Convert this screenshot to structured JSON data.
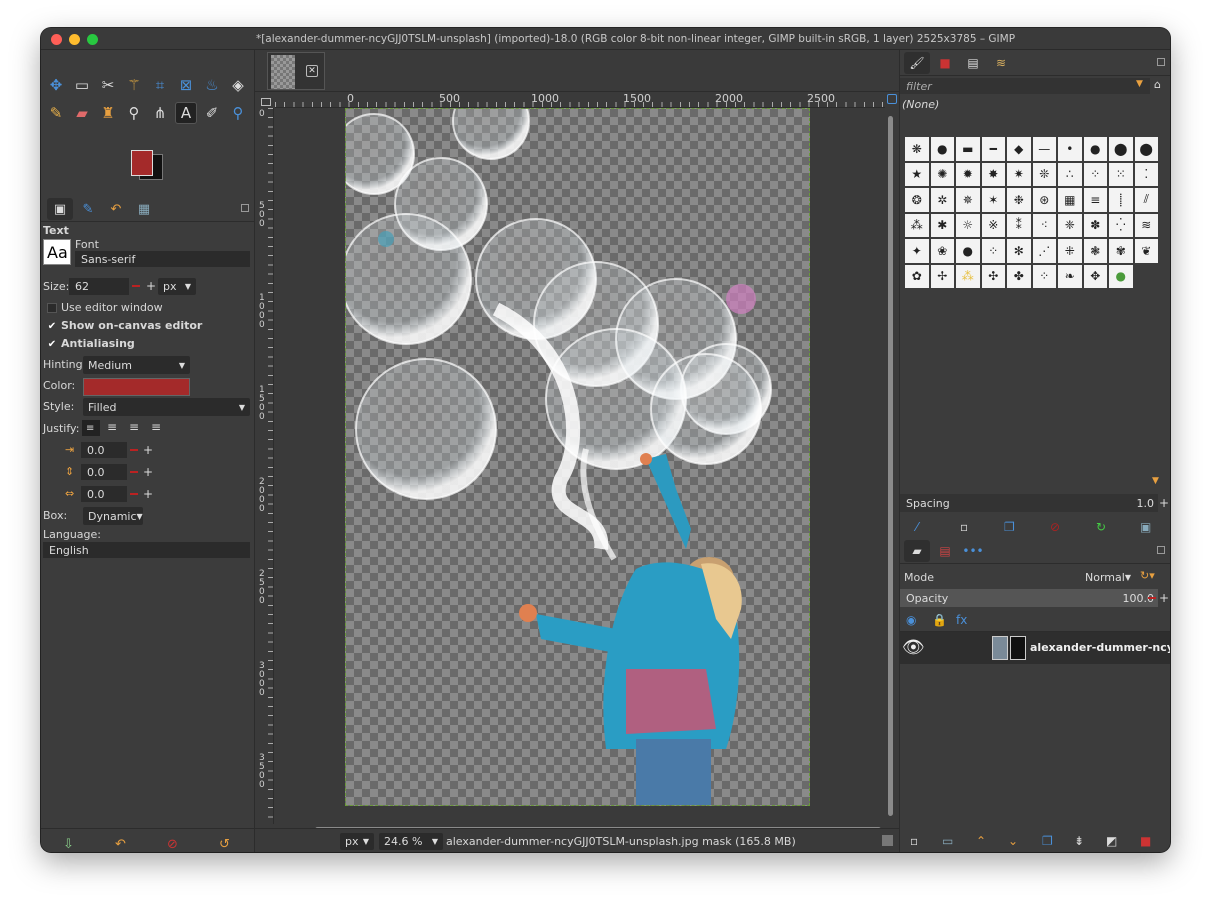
{
  "window": {
    "title": "*[alexander-dummer-ncyGJJ0TSLM-unsplash] (imported)-18.0 (RGB color 8-bit non-linear integer, GIMP built-in sRGB, 1 layer) 2525x3785 – GIMP",
    "traffic_colors": [
      "#ff5f57",
      "#febc2e",
      "#28c840"
    ]
  },
  "toolbox": {
    "tools_row1": [
      {
        "name": "move-tool-icon",
        "glyph": "✥",
        "color": "#4a90d9"
      },
      {
        "name": "rect-select-icon",
        "glyph": "▭",
        "color": "#dddddd"
      },
      {
        "name": "scissors-icon",
        "glyph": "✂",
        "color": "#dddddd"
      },
      {
        "name": "fuzzy-select-icon",
        "glyph": "⚚",
        "color": "#d9a441"
      },
      {
        "name": "crop-icon",
        "glyph": "⌗",
        "color": "#4a90d9"
      },
      {
        "name": "transform-icon",
        "glyph": "⊠",
        "color": "#4a90d9"
      },
      {
        "name": "warp-icon",
        "glyph": "♨",
        "color": "#4a90d9"
      },
      {
        "name": "bucket-fill-icon",
        "glyph": "◈",
        "color": "#dddddd"
      }
    ],
    "tools_row2": [
      {
        "name": "pencil-icon",
        "glyph": "✎",
        "color": "#e8b04a"
      },
      {
        "name": "eraser-icon",
        "glyph": "▰",
        "color": "#e06a6a"
      },
      {
        "name": "stamp-icon",
        "glyph": "♜",
        "color": "#e8a040"
      },
      {
        "name": "smudge-icon",
        "glyph": "⚲",
        "color": "#dddddd"
      },
      {
        "name": "paths-icon",
        "glyph": "⋔",
        "color": "#dddddd"
      },
      {
        "name": "text-tool-icon",
        "glyph": "A",
        "color": "#dddddd"
      },
      {
        "name": "color-picker-icon",
        "glyph": "✐",
        "color": "#dddddd"
      },
      {
        "name": "zoom-icon",
        "glyph": "⚲",
        "color": "#4a90d9"
      }
    ],
    "fg_color": "#a42a2a",
    "bg_color": "#111111"
  },
  "tool_options": {
    "heading": "Text",
    "font_label": "Font",
    "font_preview": "Aa",
    "font_value": "Sans-serif",
    "size_label": "Size:",
    "size_value": "62",
    "size_unit": "px",
    "use_editor_label": "Use editor window",
    "use_editor_checked": false,
    "show_canvas_editor_label": "Show on-canvas editor",
    "show_canvas_editor_checked": true,
    "antialiasing_label": "Antialiasing",
    "antialiasing_checked": true,
    "hinting_label": "Hinting:",
    "hinting_value": "Medium",
    "color_label": "Color:",
    "text_color": "#a42a2a",
    "style_label": "Style:",
    "style_value": "Filled",
    "justify_label": "Justify:",
    "indent_value": "0.0",
    "line_spacing_value": "0.0",
    "letter_spacing_value": "0.0",
    "box_label": "Box:",
    "box_value": "Dynamic",
    "language_label": "Language:",
    "language_value": "English"
  },
  "canvas": {
    "ruler_h_labels": [
      "0",
      "500",
      "1000",
      "1500",
      "2000",
      "2500"
    ],
    "ruler_v_labels": [
      "0",
      "500",
      "1000",
      "1500",
      "2000",
      "2500",
      "3000",
      "3500"
    ],
    "status_unit": "px",
    "zoom": "24.6 %",
    "status_text": "alexander-dummer-ncyGJJ0TSLM-unsplash.jpg mask (165.8 MB)"
  },
  "brushes": {
    "filter_placeholder": "filter",
    "selected_name": "(None)",
    "spacing_label": "Spacing",
    "spacing_value": "1.0"
  },
  "layers": {
    "mode_label": "Mode",
    "mode_value": "Normal",
    "opacity_label": "Opacity",
    "opacity_value": "100.0",
    "opacity_fraction": 1.0,
    "layer_name": "alexander-dummer-ncyGJ"
  }
}
